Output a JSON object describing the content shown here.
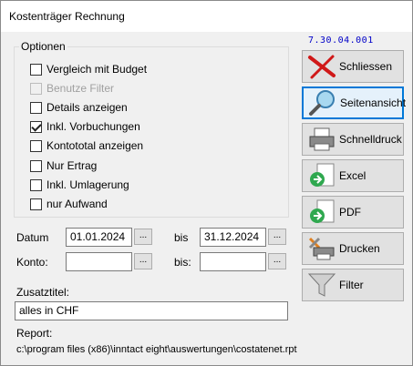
{
  "window": {
    "title": "Kostenträger Rechnung",
    "version": "7.30.04.001"
  },
  "options": {
    "legend": "Optionen",
    "items": [
      {
        "label": "Vergleich mit Budget",
        "checked": false,
        "disabled": false
      },
      {
        "label": "Benutze Filter",
        "checked": false,
        "disabled": true
      },
      {
        "label": "Details anzeigen",
        "checked": false,
        "disabled": false
      },
      {
        "label": "Inkl. Vorbuchungen",
        "checked": true,
        "disabled": false
      },
      {
        "label": "Kontototal anzeigen",
        "checked": false,
        "disabled": false
      },
      {
        "label": "Nur Ertrag",
        "checked": false,
        "disabled": false
      },
      {
        "label": "Inkl. Umlagerung",
        "checked": false,
        "disabled": false
      },
      {
        "label": "nur Aufwand",
        "checked": false,
        "disabled": false
      }
    ]
  },
  "datum": {
    "label": "Datum",
    "from": "01.01.2024",
    "bis_label": "bis",
    "to": "31.12.2024",
    "picker": "..."
  },
  "konto": {
    "label": "Konto:",
    "from": "",
    "bis_label": "bis:",
    "to": "",
    "picker": "..."
  },
  "zusatztitel": {
    "label": "Zusatztitel:",
    "value": "alles in CHF"
  },
  "report": {
    "label": "Report:",
    "path": "c:\\program files (x86)\\inntact eight\\auswertungen\\costatenet.rpt"
  },
  "buttons": {
    "schliessen": "Schliessen",
    "seitenansicht": "Seitenansicht",
    "schnelldruck": "Schnelldruck",
    "excel": "Excel",
    "pdf": "PDF",
    "drucken": "Drucken",
    "filter": "Filter"
  }
}
